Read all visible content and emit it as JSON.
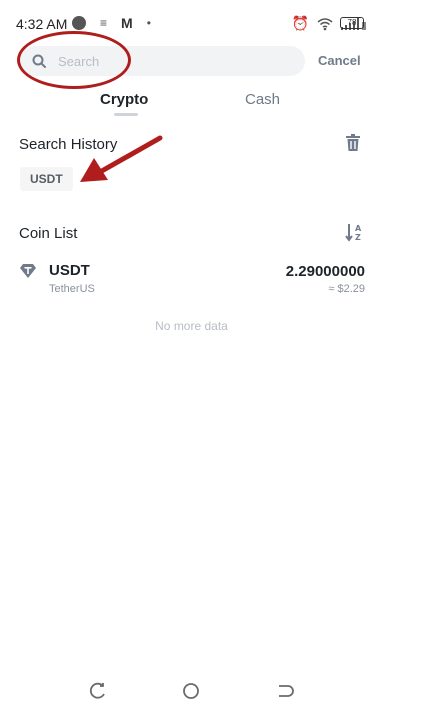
{
  "status_bar": {
    "time": "4:32 AM",
    "battery": "78"
  },
  "search": {
    "placeholder": "Search",
    "cancel_label": "Cancel"
  },
  "tabs": [
    {
      "label": "Crypto",
      "active": true
    },
    {
      "label": "Cash",
      "active": false
    }
  ],
  "search_history": {
    "title": "Search History",
    "items": [
      "USDT"
    ]
  },
  "coin_list": {
    "title": "Coin List",
    "coins": [
      {
        "symbol": "USDT",
        "name": "TetherUS",
        "amount": "2.29000000",
        "fiat_value": "≈ $2.29",
        "icon": "tether-icon"
      }
    ],
    "end_text": "No more data"
  },
  "colors": {
    "annotation": "#b01d1d",
    "text_primary": "#1e2329",
    "text_secondary": "#707a8a"
  }
}
